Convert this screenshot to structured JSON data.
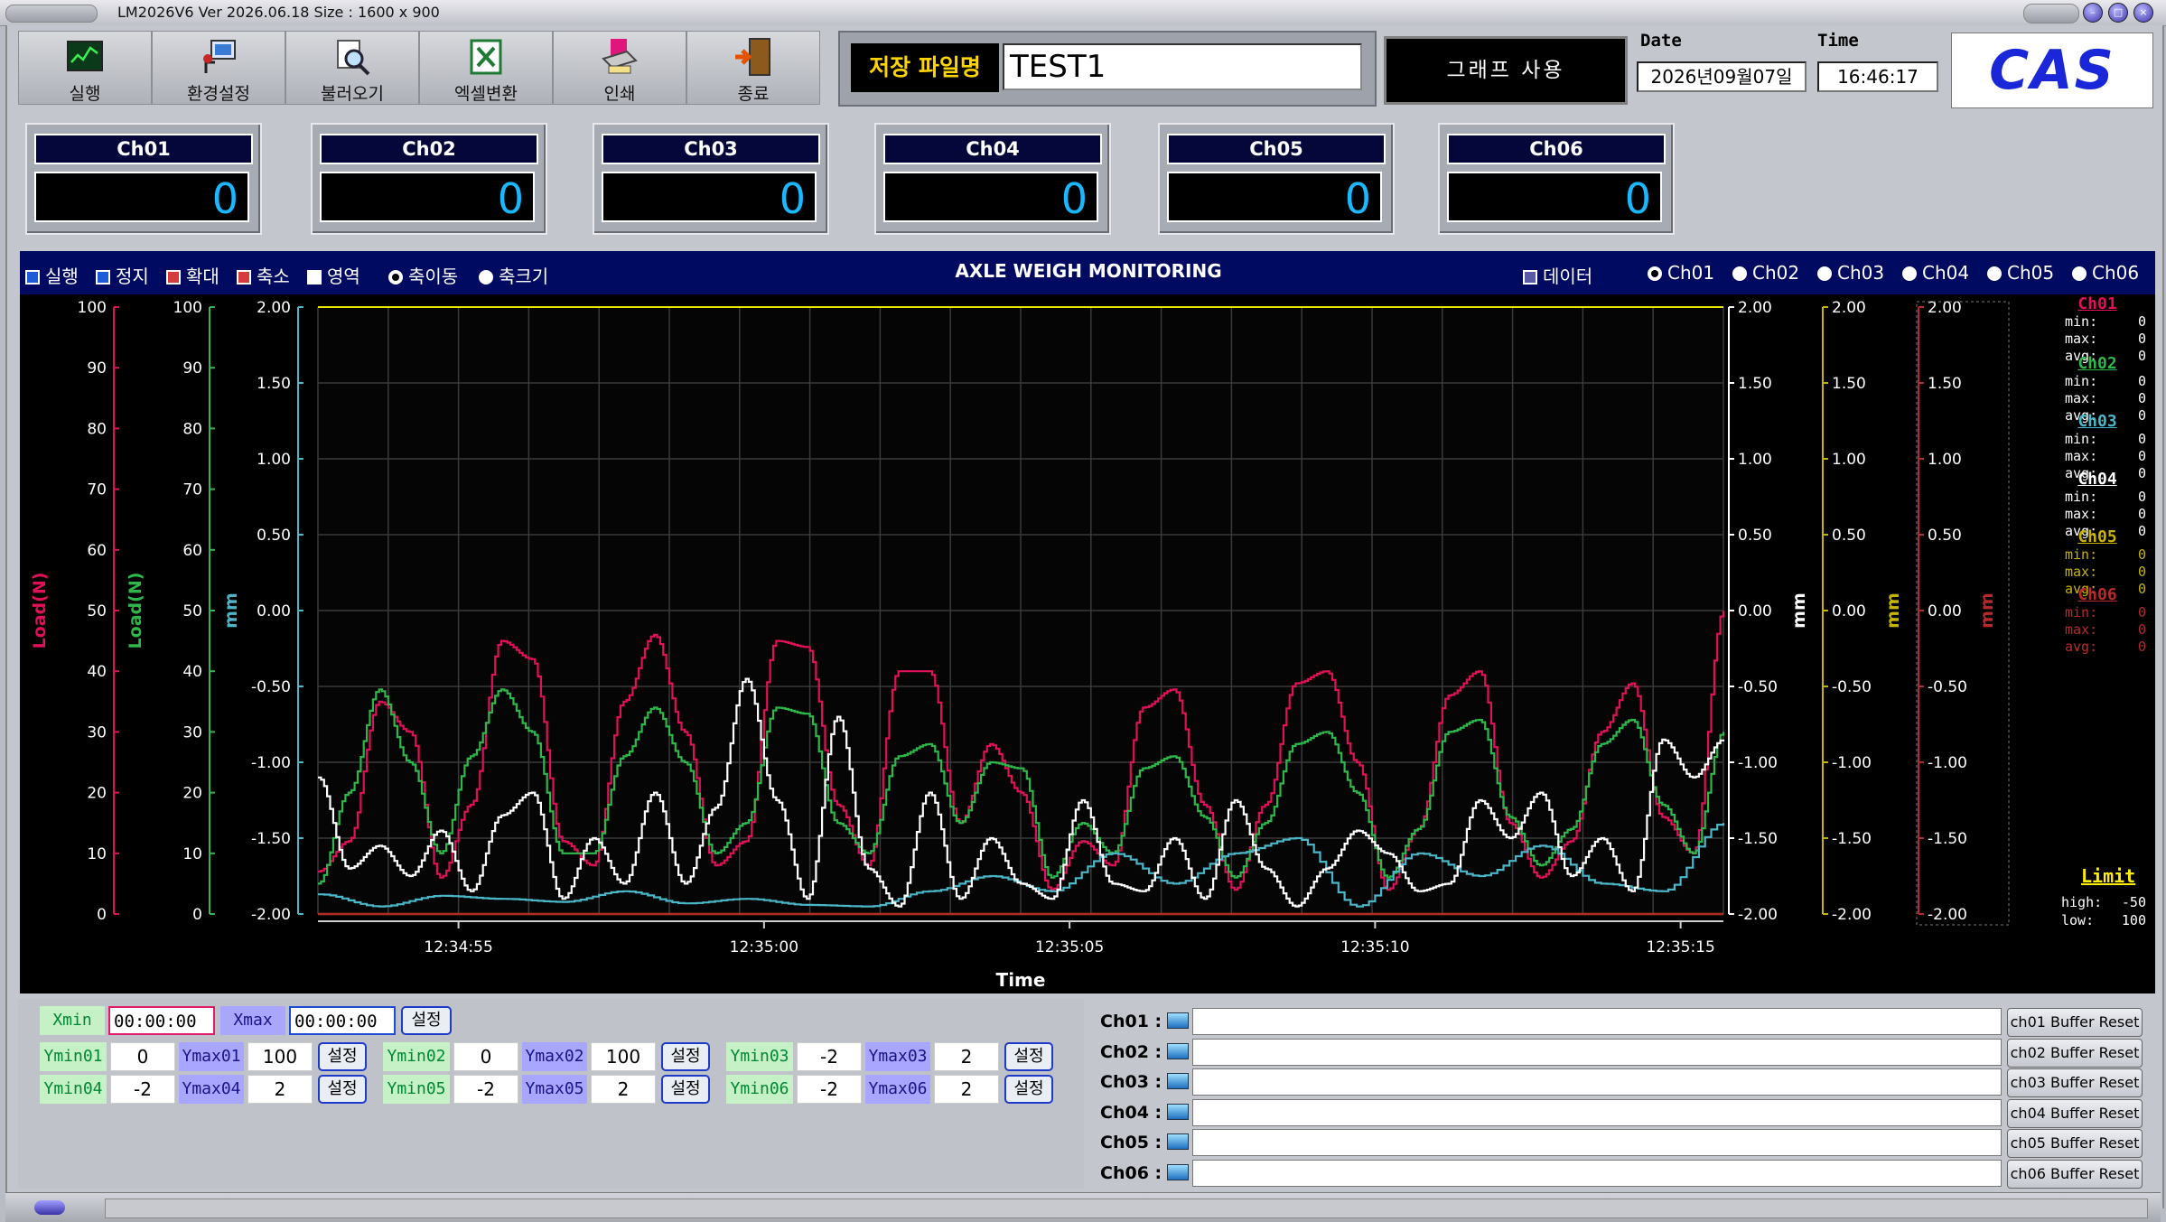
{
  "window": {
    "title": "LM2026V6  Ver 2026.06.18   Size : 1600 x 900"
  },
  "toolbar": {
    "buttons": [
      {
        "label": "실행",
        "icon": "chart-monitor-icon"
      },
      {
        "label": "환경설정",
        "icon": "settings-computer-icon"
      },
      {
        "label": "불러오기",
        "icon": "magnifier-open-icon"
      },
      {
        "label": "엑셀변환",
        "icon": "excel-icon"
      },
      {
        "label": "인쇄",
        "icon": "printer-icon"
      },
      {
        "label": "종료",
        "icon": "exit-door-icon"
      }
    ]
  },
  "file": {
    "label": "저장 파일명",
    "value": "TEST1"
  },
  "graph_button": "그래프 사용",
  "datetime": {
    "date_label": "Date",
    "date_value": "2026년09월07일",
    "time_label": "Time",
    "time_value": "16:46:17"
  },
  "logo": "CAS",
  "channels": [
    {
      "name": "Ch01",
      "value": "0"
    },
    {
      "name": "Ch02",
      "value": "0"
    },
    {
      "name": "Ch03",
      "value": "0"
    },
    {
      "name": "Ch04",
      "value": "0"
    },
    {
      "name": "Ch05",
      "value": "0"
    },
    {
      "name": "Ch06",
      "value": "0"
    }
  ],
  "plot_controls": {
    "run": "실행",
    "stop": "정지",
    "zoom_in": "확대",
    "zoom_out": "축소",
    "area": "영역",
    "axis_move": "축이동",
    "axis_size": "축크기",
    "data": "데이터",
    "channel_radios": [
      "Ch01",
      "Ch02",
      "Ch03",
      "Ch04",
      "Ch05",
      "Ch06"
    ]
  },
  "colors": {
    "ch01": "#e0105a",
    "ch02": "#2fb84a",
    "ch03": "#4ab7c8",
    "ch04": "#ffffff",
    "ch05": "#c8b400",
    "ch06": "#b82a2a",
    "grid": "#3a3a3a",
    "xaxis": "#e8e800"
  },
  "chart_data": {
    "type": "line",
    "title": "AXLE WEIGH MONITORING",
    "xlabel": "Time",
    "x_ticks": [
      "12:34:55",
      "12:35:00",
      "12:35:05",
      "12:35:10",
      "12:35:15"
    ],
    "xlim_seconds_since_start": [
      0,
      23
    ],
    "left_axes": [
      {
        "label": "Load(N)",
        "color": "#e0105a",
        "range": [
          0,
          100
        ],
        "ticks": [
          0,
          10,
          20,
          30,
          40,
          50,
          60,
          70,
          80,
          90,
          100
        ]
      },
      {
        "label": "Load(N)",
        "color": "#2fb84a",
        "range": [
          0,
          100
        ],
        "ticks": [
          0,
          10,
          20,
          30,
          40,
          50,
          60,
          70,
          80,
          90,
          100
        ]
      },
      {
        "label": "mm",
        "color": "#4ab7c8",
        "range": [
          -2,
          2
        ],
        "ticks": [
          "-2.00",
          "-1.50",
          "-1.00",
          "-0.50",
          "0.00",
          "0.50",
          "1.00",
          "1.50",
          "2.00"
        ]
      }
    ],
    "right_axes": [
      {
        "label": "mm",
        "color": "#ffffff",
        "range": [
          -2,
          2
        ]
      },
      {
        "label": "mm",
        "color": "#c8b400",
        "range": [
          -2,
          2
        ]
      },
      {
        "label": "mm",
        "color": "#b82a2a",
        "range": [
          -2,
          2
        ]
      }
    ],
    "series": [
      {
        "name": "Ch01",
        "color": "#e0105a",
        "x": [
          0,
          0.5,
          1,
          1.5,
          2,
          2.5,
          3,
          3.5,
          4,
          4.5,
          5,
          5.5,
          6,
          6.5,
          7,
          7.5,
          8,
          8.5,
          9,
          9.5,
          10,
          10.5,
          11,
          11.5,
          12,
          12.5,
          13,
          13.5,
          14,
          14.5,
          15,
          15.5,
          16,
          16.5,
          17,
          17.5,
          18,
          18.5,
          19,
          19.5,
          20,
          20.5,
          21,
          21.5,
          22,
          22.5,
          23
        ],
        "y": [
          7,
          12,
          35,
          30,
          6,
          18,
          45,
          42,
          12,
          8,
          35,
          46,
          30,
          8,
          12,
          45,
          44,
          18,
          8,
          40,
          40,
          15,
          28,
          20,
          4,
          12,
          8,
          34,
          37,
          18,
          4,
          18,
          38,
          40,
          25,
          4,
          14,
          36,
          40,
          15,
          6,
          12,
          30,
          38,
          16,
          10,
          50
        ]
      },
      {
        "name": "Ch02",
        "color": "#2fb84a",
        "x": [
          0,
          0.5,
          1,
          1.5,
          2,
          2.5,
          3,
          3.5,
          4,
          4.5,
          5,
          5.5,
          6,
          6.5,
          7,
          7.5,
          8,
          8.5,
          9,
          9.5,
          10,
          10.5,
          11,
          11.5,
          12,
          12.5,
          13,
          13.5,
          14,
          14.5,
          15,
          15.5,
          16,
          16.5,
          17,
          17.5,
          18,
          18.5,
          19,
          19.5,
          20,
          20.5,
          21,
          21.5,
          22,
          22.5,
          23
        ],
        "y": [
          5,
          20,
          37,
          25,
          10,
          26,
          37,
          30,
          10,
          10,
          26,
          34,
          25,
          10,
          15,
          34,
          33,
          15,
          10,
          26,
          28,
          15,
          25,
          24,
          6,
          15,
          10,
          24,
          26,
          16,
          6,
          15,
          28,
          30,
          20,
          6,
          14,
          30,
          32,
          16,
          8,
          14,
          28,
          32,
          18,
          10,
          30
        ]
      },
      {
        "name": "Ch03",
        "color": "#4ab7c8",
        "x": [
          0,
          1,
          2,
          3,
          4,
          5,
          6,
          7,
          8,
          9,
          10,
          11,
          12,
          13,
          14,
          15,
          16,
          17,
          18,
          19,
          20,
          21,
          22,
          23
        ],
        "y": [
          -1.87,
          -1.95,
          -1.88,
          -1.9,
          -1.92,
          -1.85,
          -1.93,
          -1.9,
          -1.94,
          -1.95,
          -1.85,
          -1.75,
          -1.85,
          -1.6,
          -1.8,
          -1.6,
          -1.5,
          -1.95,
          -1.6,
          -1.75,
          -1.55,
          -1.8,
          -1.85,
          -1.4
        ]
      },
      {
        "name": "Ch04",
        "color": "#ffffff",
        "x": [
          0,
          0.5,
          1,
          1.5,
          2,
          2.5,
          3,
          3.5,
          4,
          4.5,
          5,
          5.5,
          6,
          6.5,
          7,
          7.5,
          8,
          8.5,
          9,
          9.5,
          10,
          10.5,
          11,
          11.5,
          12,
          12.5,
          13,
          13.5,
          14,
          14.5,
          15,
          15.5,
          16,
          16.5,
          17,
          17.5,
          18,
          18.5,
          19,
          19.5,
          20,
          20.5,
          21,
          21.5,
          22,
          22.5,
          23
        ],
        "y": [
          -1.1,
          -1.7,
          -1.55,
          -1.75,
          -1.45,
          -1.85,
          -1.35,
          -1.2,
          -1.9,
          -1.5,
          -1.8,
          -1.2,
          -1.8,
          -1.3,
          -0.45,
          -1.25,
          -1.9,
          -0.7,
          -1.7,
          -1.95,
          -1.2,
          -1.9,
          -1.5,
          -1.8,
          -1.9,
          -1.25,
          -1.8,
          -1.85,
          -1.5,
          -1.9,
          -1.25,
          -1.7,
          -1.95,
          -1.7,
          -1.45,
          -1.6,
          -1.85,
          -1.8,
          -1.25,
          -1.5,
          -1.2,
          -1.75,
          -1.5,
          -1.85,
          -0.85,
          -1.1,
          -0.85
        ]
      },
      {
        "name": "Ch05",
        "color": "#c8b400",
        "x": [
          0,
          23
        ],
        "y": [
          -2,
          -2
        ]
      },
      {
        "name": "Ch06",
        "color": "#b82a2a",
        "x": [
          0,
          23
        ],
        "y": [
          -2,
          -2
        ]
      }
    ]
  },
  "stats": [
    {
      "name": "Ch01",
      "color": "#e0105a",
      "min": "0",
      "max": "0",
      "avg": "0"
    },
    {
      "name": "Ch02",
      "color": "#2fb84a",
      "min": "0",
      "max": "0",
      "avg": "0"
    },
    {
      "name": "Ch03",
      "color": "#4ab7c8",
      "min": "0",
      "max": "0",
      "avg": "0"
    },
    {
      "name": "Ch04",
      "color": "#ffffff",
      "min": "0",
      "max": "0",
      "avg": "0"
    },
    {
      "name": "Ch05",
      "color": "#c8b400",
      "min": "0",
      "max": "0",
      "avg": "0"
    },
    {
      "name": "Ch06",
      "color": "#b82a2a",
      "min": "0",
      "max": "0",
      "avg": "0"
    }
  ],
  "stat_labels": {
    "min": "min:",
    "max": "max:",
    "avg": "avg:"
  },
  "limit": {
    "title": "Limit",
    "high_label": "high:",
    "high": "-50",
    "low_label": "low:",
    "low": "100"
  },
  "axis_settings": {
    "xmin_label": "Xmin",
    "xmin": "00:00:00",
    "xmax_label": "Xmax",
    "xmax": "00:00:00",
    "set": "설정",
    "rows": [
      [
        {
          "min_label": "Ymin01",
          "min": "0",
          "max_label": "Ymax01",
          "max": "100"
        },
        {
          "min_label": "Ymin02",
          "min": "0",
          "max_label": "Ymax02",
          "max": "100"
        },
        {
          "min_label": "Ymin03",
          "min": "-2",
          "max_label": "Ymax03",
          "max": "2"
        }
      ],
      [
        {
          "min_label": "Ymin04",
          "min": "-2",
          "max_label": "Ymax04",
          "max": "2"
        },
        {
          "min_label": "Ymin05",
          "min": "-2",
          "max_label": "Ymax05",
          "max": "2"
        },
        {
          "min_label": "Ymin06",
          "min": "-2",
          "max_label": "Ymax06",
          "max": "2"
        }
      ]
    ]
  },
  "buffers": [
    {
      "label": "Ch01 :",
      "reset": "ch01 Buffer Reset"
    },
    {
      "label": "Ch02 :",
      "reset": "ch02 Buffer Reset"
    },
    {
      "label": "Ch03 :",
      "reset": "ch03 Buffer Reset"
    },
    {
      "label": "Ch04 :",
      "reset": "ch04 Buffer Reset"
    },
    {
      "label": "Ch05 :",
      "reset": "ch05 Buffer Reset"
    },
    {
      "label": "Ch06 :",
      "reset": "ch06 Buffer Reset"
    }
  ]
}
